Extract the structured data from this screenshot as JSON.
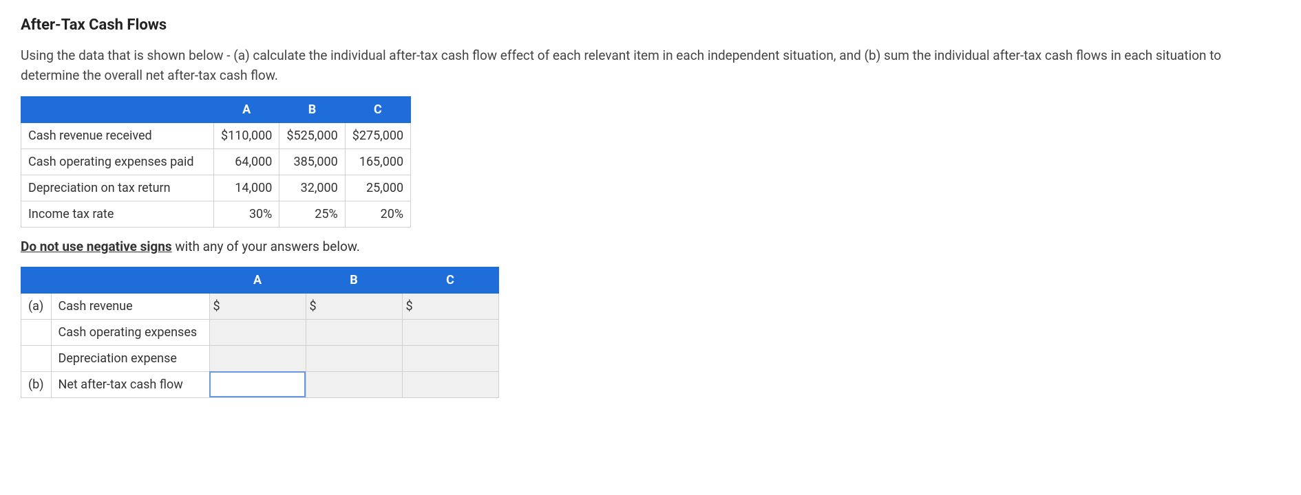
{
  "title": "After-Tax Cash Flows",
  "description": "Using the data that is shown below - (a) calculate the individual after-tax cash flow effect of each relevant item in each independent situation, and (b) sum the individual after-tax cash flows in each situation to determine the overall net after-tax cash flow.",
  "data_table": {
    "headers": [
      "",
      "A",
      "B",
      "C"
    ],
    "rows": [
      {
        "label": "Cash revenue received",
        "A": "$110,000",
        "B": "$525,000",
        "C": "$275,000"
      },
      {
        "label": "Cash operating expenses paid",
        "A": "64,000",
        "B": "385,000",
        "C": "165,000"
      },
      {
        "label": "Depreciation on tax return",
        "A": "14,000",
        "B": "32,000",
        "C": "25,000"
      },
      {
        "label": "Income tax rate",
        "A": "30%",
        "B": "25%",
        "C": "20%"
      }
    ]
  },
  "instruction_bold": "Do not use negative signs",
  "instruction_rest": " with any of your answers below.",
  "answer_table": {
    "headers": [
      "",
      "",
      "A",
      "B",
      "C"
    ],
    "rows": [
      {
        "part": "(a)",
        "label": "Cash revenue",
        "currency": "$"
      },
      {
        "part": "",
        "label": "Cash operating expenses",
        "currency": ""
      },
      {
        "part": "",
        "label": "Depreciation expense",
        "currency": ""
      },
      {
        "part": "(b)",
        "label": "Net after-tax cash flow",
        "currency": ""
      }
    ]
  }
}
